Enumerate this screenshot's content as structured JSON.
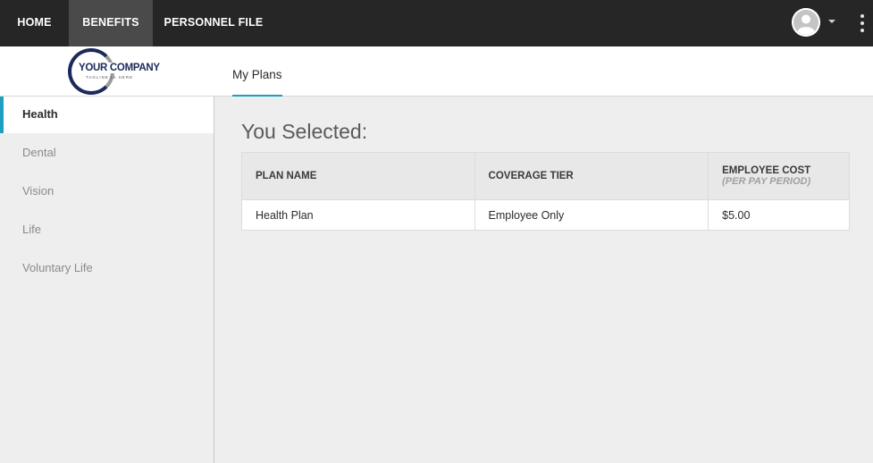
{
  "topnav": {
    "items": [
      {
        "label": "HOME"
      },
      {
        "label": "BENEFITS"
      },
      {
        "label": "PERSONNEL FILE"
      }
    ],
    "active_item": "BENEFITS"
  },
  "logo": {
    "company": "YOUR COMPANY",
    "tagline": "TAGLINE IS HERE"
  },
  "subheader": {
    "tab_label": "My Plans"
  },
  "sidebar": {
    "items": [
      {
        "label": "Health"
      },
      {
        "label": "Dental"
      },
      {
        "label": "Vision"
      },
      {
        "label": "Life"
      },
      {
        "label": "Voluntary Life"
      }
    ],
    "active_item": "Health"
  },
  "main": {
    "title": "You Selected:",
    "table": {
      "headers": {
        "plan_name": "PLAN NAME",
        "coverage_tier": "COVERAGE TIER",
        "employee_cost": "EMPLOYEE COST",
        "employee_cost_sub": "(PER PAY PERIOD)"
      },
      "rows": [
        {
          "plan_name": "Health Plan",
          "coverage_tier": "Employee Only",
          "employee_cost": "$5.00"
        }
      ]
    }
  },
  "icons": {
    "avatar": "user-avatar-icon",
    "caret": "caret-down-icon",
    "menu": "more-vertical-icon"
  },
  "colors": {
    "nav_bg": "#262626",
    "nav_active_bg": "#4a4a4a",
    "accent": "#1d9fc1",
    "page_bg": "#eeeeee"
  }
}
